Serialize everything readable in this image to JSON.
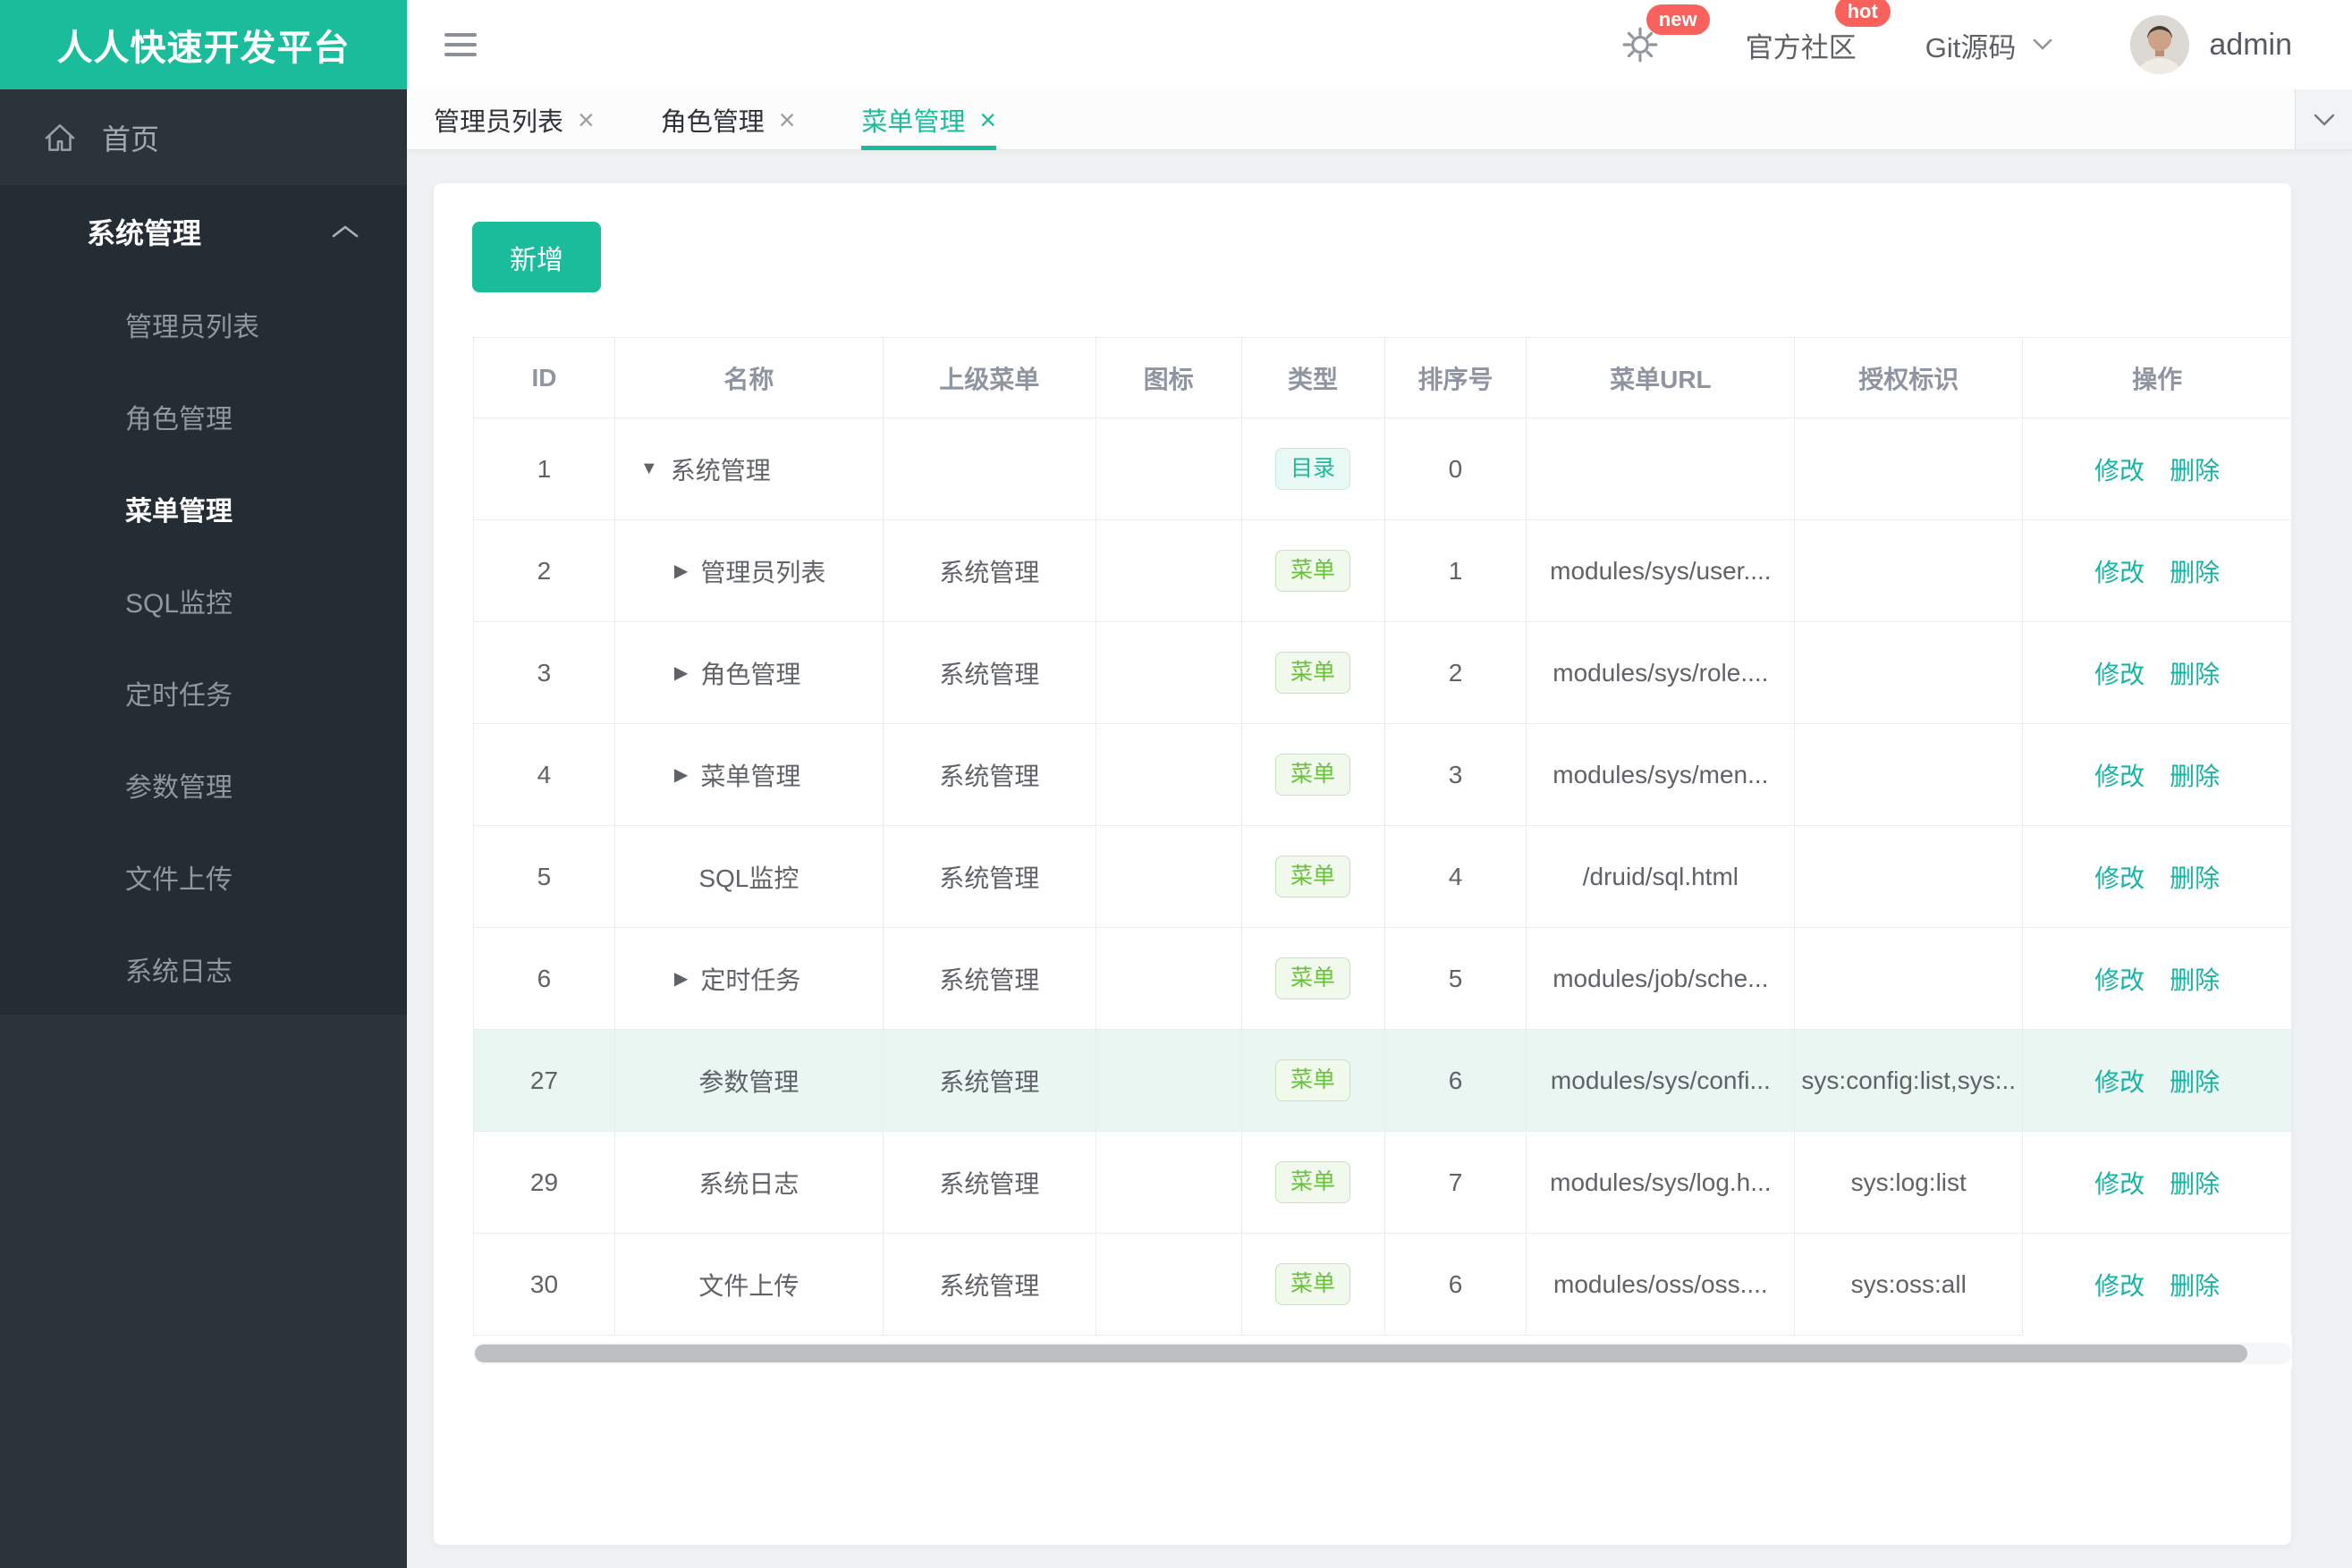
{
  "app": {
    "title": "人人快速开发平台"
  },
  "colors": {
    "brand": "#1abc9c",
    "link": "#17b3a3",
    "badge_red": "#f9625c",
    "tag_dir_text": "#1abc9c",
    "tag_dir_bg": "#e8f8f4",
    "tag_menu_text": "#67c23a",
    "tag_menu_bg": "#f0f9eb",
    "row_highlight": "#e9f6f2",
    "sidebar_bg": "#2b343b",
    "sidebar_submenu_bg": "#242d34"
  },
  "header": {
    "badges": {
      "settings": "new",
      "community": "hot"
    },
    "community_label": "官方社区",
    "git_label": "Git源码",
    "username": "admin"
  },
  "sidebar": {
    "home_label": "首页",
    "group": {
      "label": "系统管理",
      "expanded": true,
      "items": [
        {
          "label": "管理员列表",
          "active": false
        },
        {
          "label": "角色管理",
          "active": false
        },
        {
          "label": "菜单管理",
          "active": true
        },
        {
          "label": "SQL监控",
          "active": false
        },
        {
          "label": "定时任务",
          "active": false
        },
        {
          "label": "参数管理",
          "active": false
        },
        {
          "label": "文件上传",
          "active": false
        },
        {
          "label": "系统日志",
          "active": false
        }
      ]
    }
  },
  "tabs": [
    {
      "label": "管理员列表",
      "active": false
    },
    {
      "label": "角色管理",
      "active": false
    },
    {
      "label": "菜单管理",
      "active": true
    }
  ],
  "toolbar": {
    "add_label": "新增"
  },
  "table": {
    "columns": [
      "ID",
      "名称",
      "上级菜单",
      "图标",
      "类型",
      "排序号",
      "菜单URL",
      "授权标识",
      "操作"
    ],
    "ops_labels": [
      "修改",
      "删除"
    ],
    "rows": [
      {
        "id": "1",
        "arrow": "down",
        "indent": false,
        "name": "系统管理",
        "parent": "",
        "icon": "",
        "type": "目录",
        "type_variant": "dir",
        "order": "0",
        "url": "",
        "auth": "",
        "highlighted": false
      },
      {
        "id": "2",
        "arrow": "right",
        "indent": true,
        "name": "管理员列表",
        "parent": "系统管理",
        "icon": "",
        "type": "菜单",
        "type_variant": "menu",
        "order": "1",
        "url": "modules/sys/user....",
        "auth": "",
        "highlighted": false
      },
      {
        "id": "3",
        "arrow": "right",
        "indent": true,
        "name": "角色管理",
        "parent": "系统管理",
        "icon": "",
        "type": "菜单",
        "type_variant": "menu",
        "order": "2",
        "url": "modules/sys/role....",
        "auth": "",
        "highlighted": false
      },
      {
        "id": "4",
        "arrow": "right",
        "indent": true,
        "name": "菜单管理",
        "parent": "系统管理",
        "icon": "",
        "type": "菜单",
        "type_variant": "menu",
        "order": "3",
        "url": "modules/sys/men...",
        "auth": "",
        "highlighted": false
      },
      {
        "id": "5",
        "arrow": null,
        "indent": true,
        "name": "SQL监控",
        "parent": "系统管理",
        "icon": "",
        "type": "菜单",
        "type_variant": "menu",
        "order": "4",
        "url": "/druid/sql.html",
        "auth": "",
        "highlighted": false
      },
      {
        "id": "6",
        "arrow": "right",
        "indent": true,
        "name": "定时任务",
        "parent": "系统管理",
        "icon": "",
        "type": "菜单",
        "type_variant": "menu",
        "order": "5",
        "url": "modules/job/sche...",
        "auth": "",
        "highlighted": false
      },
      {
        "id": "27",
        "arrow": null,
        "indent": true,
        "name": "参数管理",
        "parent": "系统管理",
        "icon": "",
        "type": "菜单",
        "type_variant": "menu",
        "order": "6",
        "url": "modules/sys/confi...",
        "auth": "sys:config:list,sys:..",
        "highlighted": true
      },
      {
        "id": "29",
        "arrow": null,
        "indent": true,
        "name": "系统日志",
        "parent": "系统管理",
        "icon": "",
        "type": "菜单",
        "type_variant": "menu",
        "order": "7",
        "url": "modules/sys/log.h...",
        "auth": "sys:log:list",
        "highlighted": false
      },
      {
        "id": "30",
        "arrow": null,
        "indent": true,
        "name": "文件上传",
        "parent": "系统管理",
        "icon": "",
        "type": "菜单",
        "type_variant": "menu",
        "order": "6",
        "url": "modules/oss/oss....",
        "auth": "sys:oss:all",
        "highlighted": false
      }
    ]
  }
}
